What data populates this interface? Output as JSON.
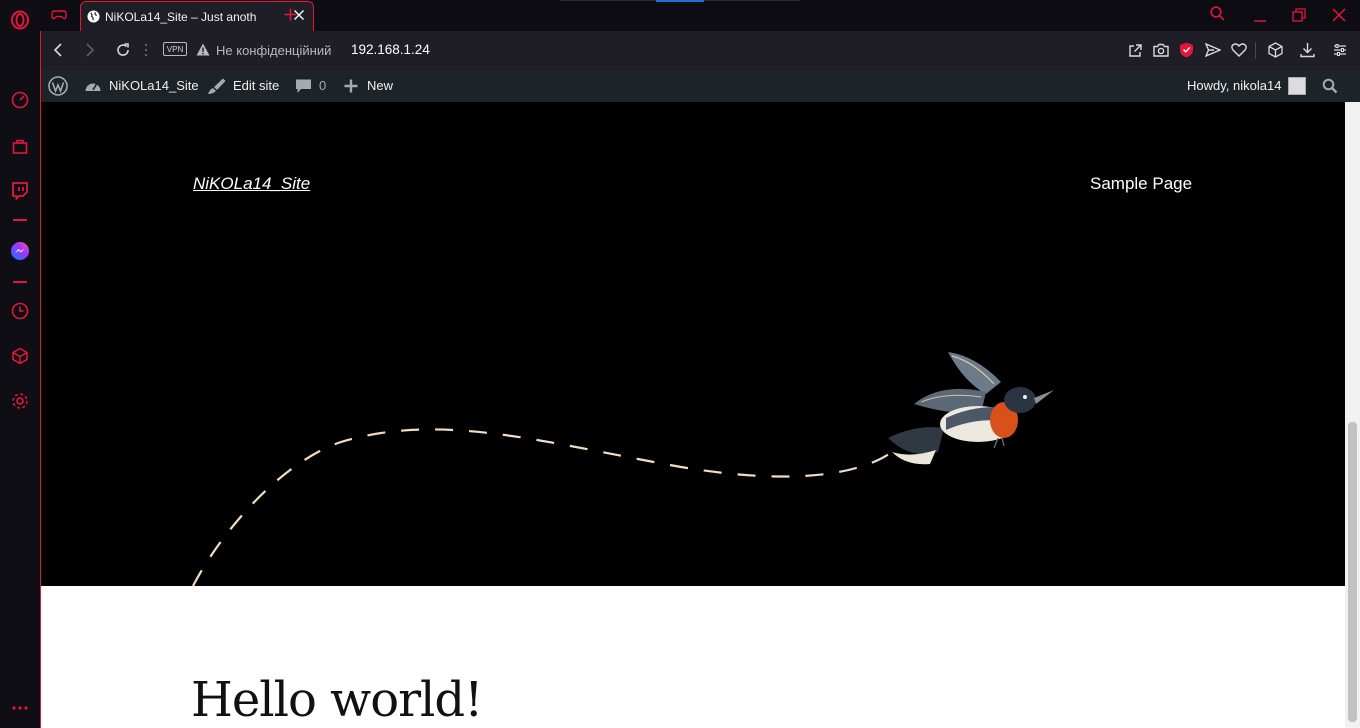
{
  "browser": {
    "tab_title": "NiKOLa14_Site – Just anoth",
    "address_security": "Не конфіденційний",
    "address_url": "192.168.1.24",
    "vpn_label": "VPN"
  },
  "wp_admin_bar": {
    "site_name": "NiKOLa14_Site",
    "edit_site": "Edit site",
    "comments_count": "0",
    "new_label": "New",
    "howdy": "Howdy, nikola14"
  },
  "site": {
    "title": "NiKOLa14_Site",
    "nav_sample_page": "Sample Page",
    "post_title": "Hello world!"
  },
  "colors": {
    "opera_accent": "#e4173a",
    "wp_bar_bg": "#1d2327",
    "hero_bg": "#000000"
  }
}
